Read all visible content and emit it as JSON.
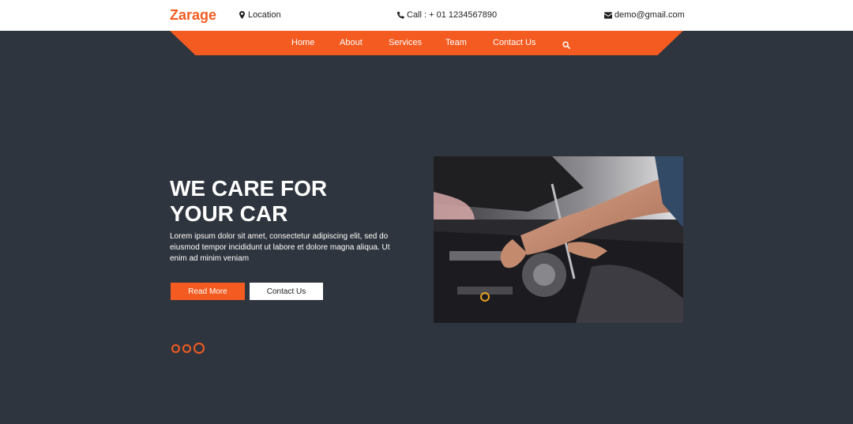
{
  "header": {
    "brand": "Zarage",
    "location": "Location",
    "call": "Call : + 01 1234567890",
    "email": "demo@gmail.com"
  },
  "nav": {
    "items": [
      "Home",
      "About",
      "Services",
      "Team",
      "Contact Us"
    ],
    "search_icon": "search-icon"
  },
  "hero": {
    "title": "WE CARE FOR YOUR CAR",
    "text": "Lorem ipsum dolor sit amet, consectetur adipiscing elit, sed do eiusmod tempor incididunt ut labore et dolore magna aliqua. Ut enim ad minim veniam",
    "read_more": "Read More",
    "contact_us": "Contact Us",
    "active_slide": 3
  },
  "colors": {
    "accent": "#f45b21",
    "background": "#2f353e",
    "header": "#ffffff"
  }
}
